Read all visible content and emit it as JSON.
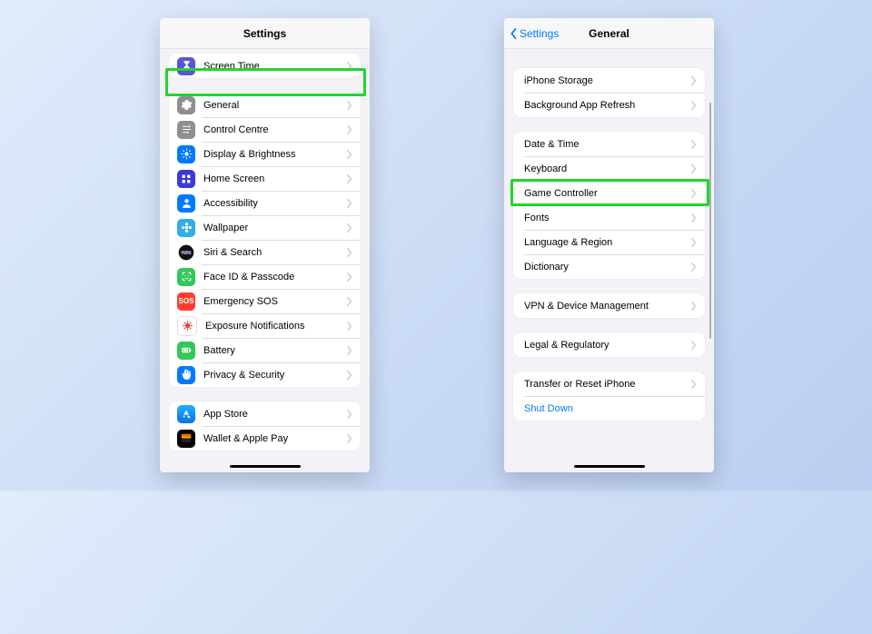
{
  "left": {
    "nav_title": "Settings",
    "group0": {
      "items": [
        {
          "label": "Screen Time"
        }
      ]
    },
    "group1": {
      "items": [
        {
          "label": "General"
        },
        {
          "label": "Control Centre"
        },
        {
          "label": "Display & Brightness"
        },
        {
          "label": "Home Screen"
        },
        {
          "label": "Accessibility"
        },
        {
          "label": "Wallpaper"
        },
        {
          "label": "Siri & Search"
        },
        {
          "label": "Face ID & Passcode"
        },
        {
          "label": "Emergency SOS"
        },
        {
          "label": "Exposure Notifications"
        },
        {
          "label": "Battery"
        },
        {
          "label": "Privacy & Security"
        }
      ]
    },
    "group2": {
      "items": [
        {
          "label": "App Store"
        },
        {
          "label": "Wallet & Apple Pay"
        }
      ]
    }
  },
  "right": {
    "nav_back": "Settings",
    "nav_title": "General",
    "group0": {
      "items": [
        {
          "label": "iPhone Storage"
        },
        {
          "label": "Background App Refresh"
        }
      ]
    },
    "group1": {
      "items": [
        {
          "label": "Date & Time"
        },
        {
          "label": "Keyboard"
        },
        {
          "label": "Game Controller"
        },
        {
          "label": "Fonts"
        },
        {
          "label": "Language & Region"
        },
        {
          "label": "Dictionary"
        }
      ]
    },
    "group2": {
      "items": [
        {
          "label": "VPN & Device Management"
        }
      ]
    },
    "group3": {
      "items": [
        {
          "label": "Legal & Regulatory"
        }
      ]
    },
    "group4": {
      "items": [
        {
          "label": "Transfer or Reset iPhone"
        },
        {
          "label": "Shut Down"
        }
      ]
    }
  }
}
